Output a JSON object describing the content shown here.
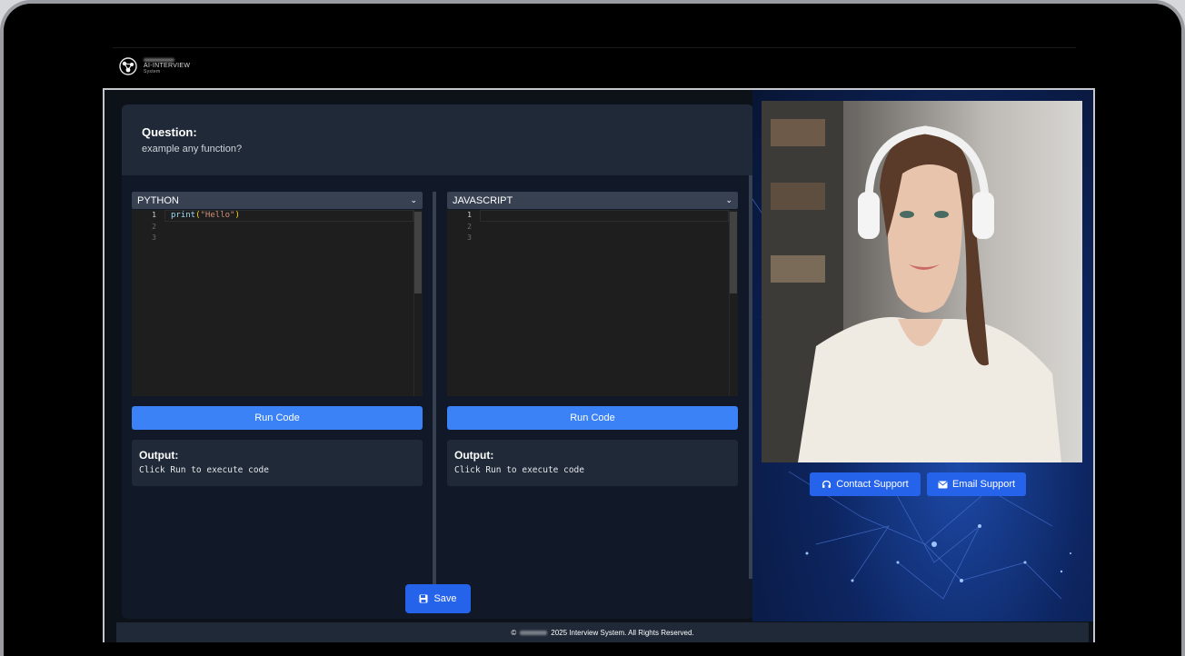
{
  "logo": {
    "brand": "AI-INTERVIEW",
    "sub": "System"
  },
  "question": {
    "label": "Question:",
    "text": "example any function?"
  },
  "panes": [
    {
      "language": "PYTHON",
      "line_numbers": [
        "1",
        "2",
        "3"
      ],
      "code": {
        "fn": "print",
        "open": "(",
        "arg": "\"Hello\"",
        "close": ")"
      },
      "run_label": "Run Code",
      "output_label": "Output:",
      "output_text": "Click Run to execute code"
    },
    {
      "language": "JAVASCRIPT",
      "line_numbers": [
        "1",
        "2",
        "3"
      ],
      "run_label": "Run Code",
      "output_label": "Output:",
      "output_text": "Click Run to execute code"
    }
  ],
  "save_label": "Save",
  "support": {
    "contact_label": "Contact Support",
    "email_label": "Email Support"
  },
  "footer": {
    "prefix": "©",
    "text": "2025 Interview System. All Rights Reserved."
  },
  "colors": {
    "primary": "#3b82f6",
    "save": "#2563eb",
    "panel": "#1f2937"
  }
}
